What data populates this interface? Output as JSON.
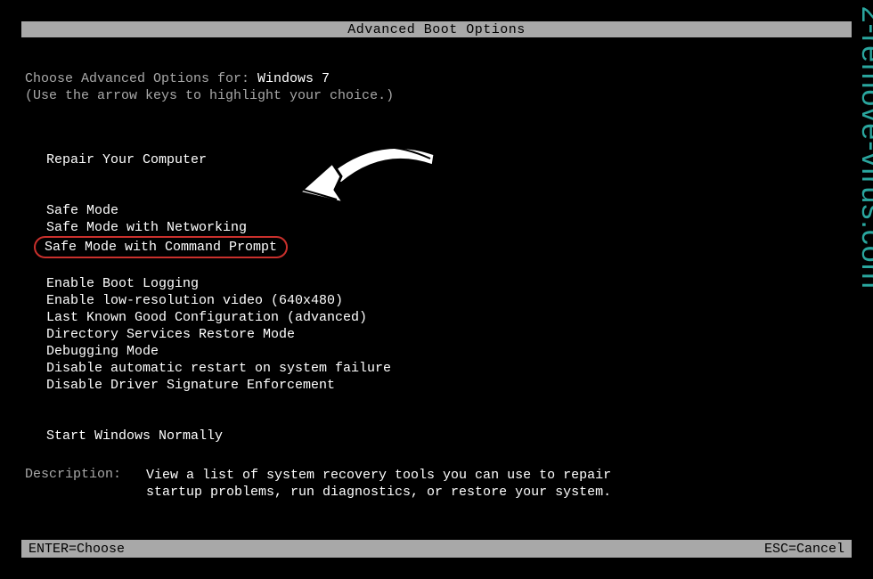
{
  "title": "Advanced Boot Options",
  "choose_prefix": "Choose Advanced Options for: ",
  "os_name": "Windows 7",
  "hint": "(Use the arrow keys to highlight your choice.)",
  "menu": {
    "group1": [
      "Repair Your Computer"
    ],
    "group2": [
      "Safe Mode",
      "Safe Mode with Networking",
      "Safe Mode with Command Prompt"
    ],
    "group3": [
      "Enable Boot Logging",
      "Enable low-resolution video (640x480)",
      "Last Known Good Configuration (advanced)",
      "Directory Services Restore Mode",
      "Debugging Mode",
      "Disable automatic restart on system failure",
      "Disable Driver Signature Enforcement"
    ],
    "group4": [
      "Start Windows Normally"
    ],
    "highlighted_index": 2
  },
  "description": {
    "label": "Description:",
    "text": "View a list of system recovery tools you can use to repair startup problems, run diagnostics, or restore your system."
  },
  "footer": {
    "left": "ENTER=Choose",
    "right": "ESC=Cancel"
  },
  "watermark": "2-remove-virus.com"
}
